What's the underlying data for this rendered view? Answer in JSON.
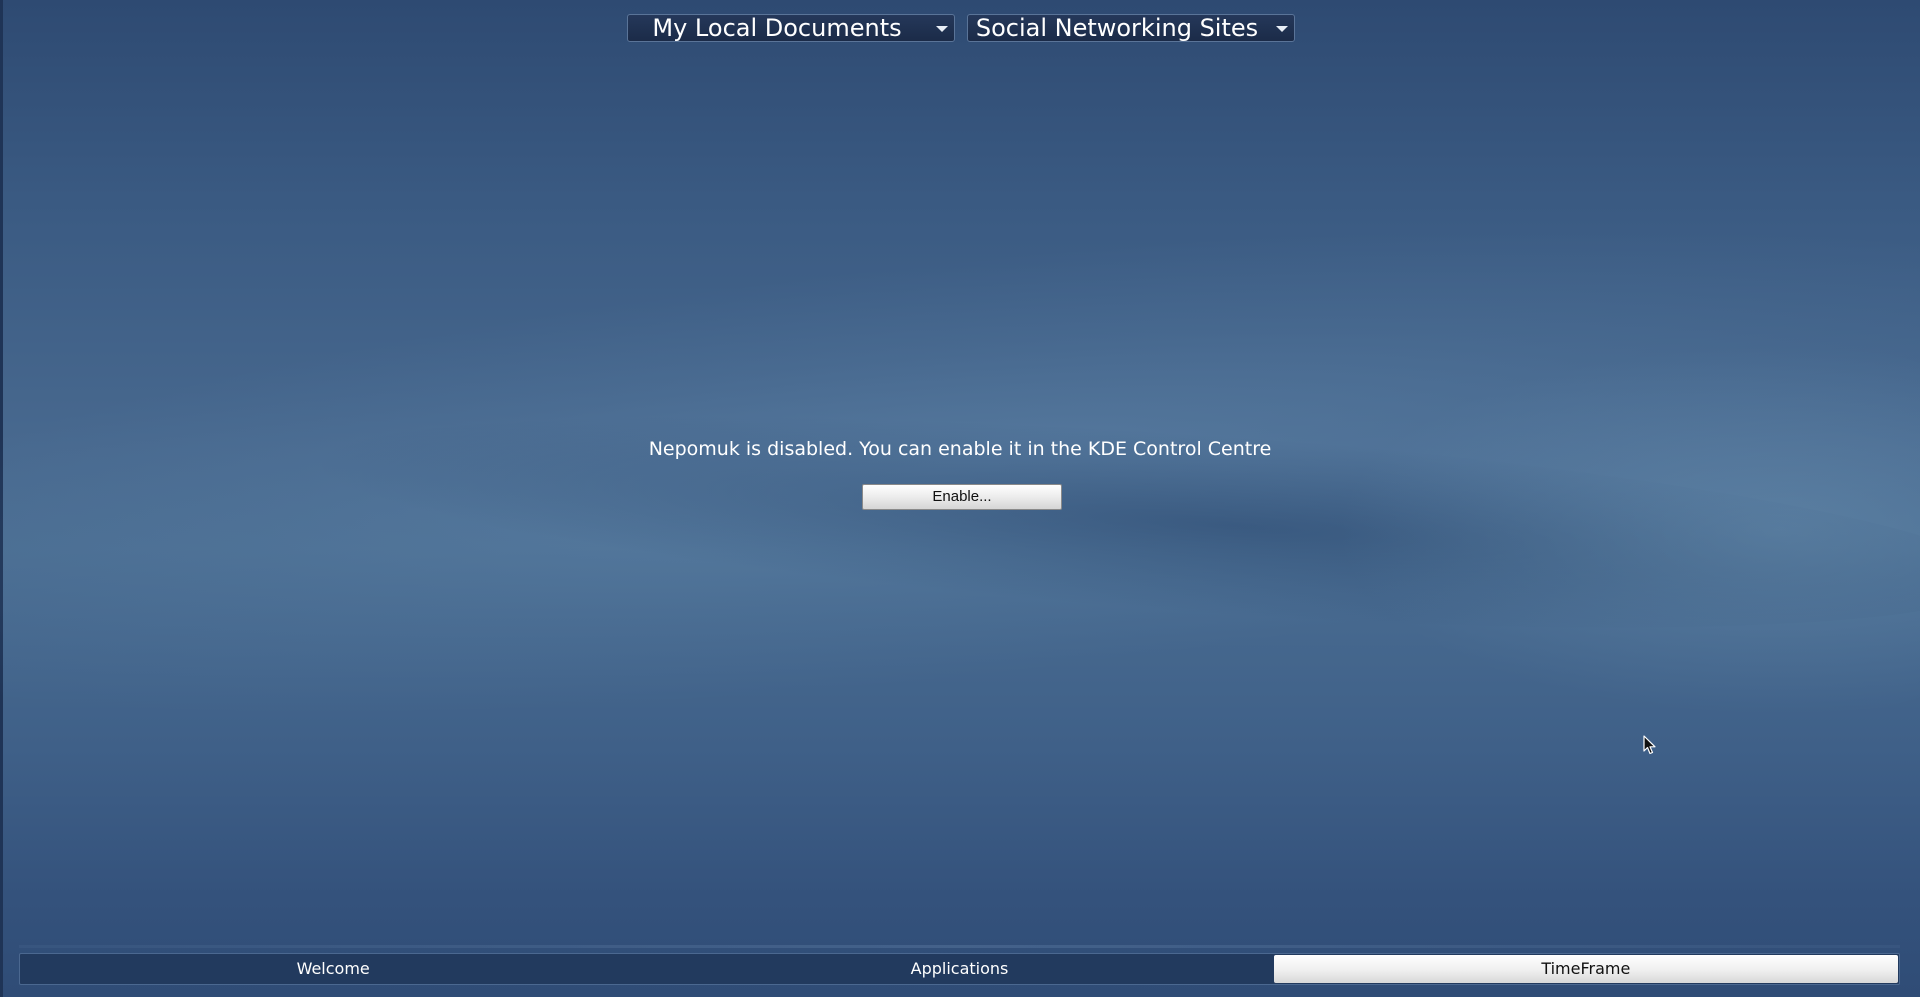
{
  "top_panel": {
    "left_dropdown": {
      "label": "My Local Documents"
    },
    "right_dropdown": {
      "label": "Social Networking Sites"
    }
  },
  "main": {
    "message": "Nepomuk is disabled. You can enable it in the KDE Control Centre",
    "enable_button_label": "Enable..."
  },
  "bottom_tabs": {
    "items": [
      {
        "label": "Welcome",
        "active": false
      },
      {
        "label": "Applications",
        "active": false
      },
      {
        "label": "TimeFrame",
        "active": true
      }
    ]
  },
  "icons": {
    "dropdown_arrow": "chevron-down-icon",
    "cursor": "mouse-cursor-icon"
  },
  "colors": {
    "background": "#3f6088",
    "panel": "#1b2b48",
    "active_tab": "#efefef"
  }
}
